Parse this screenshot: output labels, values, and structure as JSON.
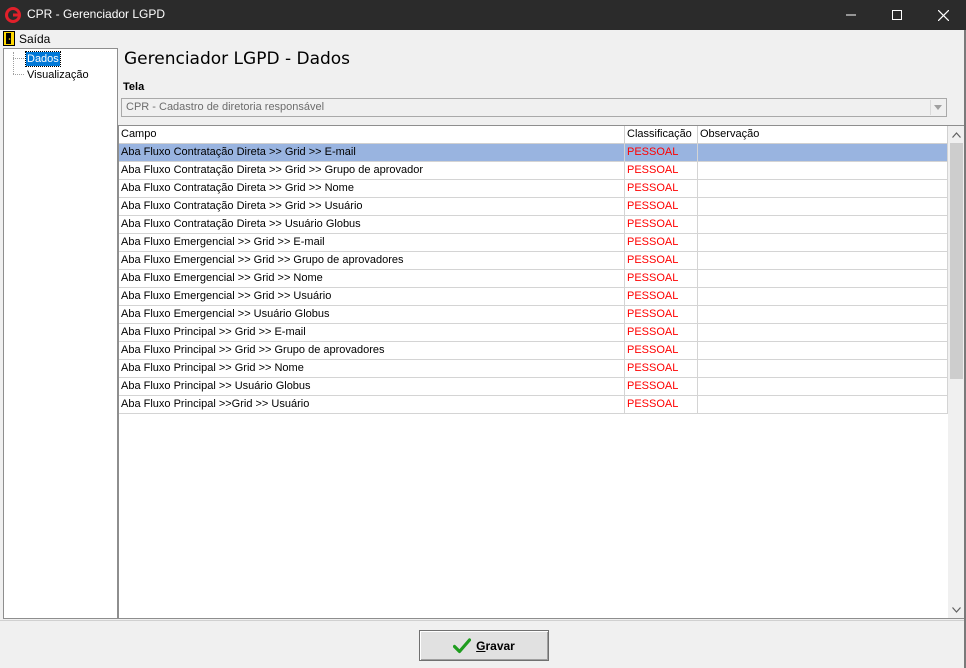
{
  "window": {
    "title": "CPR - Gerenciador LGPD"
  },
  "menu": {
    "exit_label": "Saída"
  },
  "tree": {
    "items": [
      {
        "label": "Dados",
        "selected": true
      },
      {
        "label": "Visualização",
        "selected": false
      }
    ]
  },
  "page": {
    "title": "Gerenciador LGPD - Dados"
  },
  "tela": {
    "label": "Tela",
    "value": "CPR - Cadastro de diretoria responsável"
  },
  "grid": {
    "columns": {
      "campo": "Campo",
      "classificacao": "Classificação",
      "observacao": "Observação"
    },
    "rows": [
      {
        "campo": "Aba Fluxo Contratação Direta >> Grid >> E-mail",
        "classificacao": "PESSOAL",
        "observacao": ""
      },
      {
        "campo": "Aba Fluxo Contratação Direta >> Grid >> Grupo de aprovador",
        "classificacao": "PESSOAL",
        "observacao": ""
      },
      {
        "campo": "Aba Fluxo Contratação Direta >> Grid >> Nome",
        "classificacao": "PESSOAL",
        "observacao": ""
      },
      {
        "campo": "Aba Fluxo Contratação Direta >> Grid >> Usuário",
        "classificacao": "PESSOAL",
        "observacao": ""
      },
      {
        "campo": "Aba Fluxo Contratação Direta >> Usuário Globus",
        "classificacao": "PESSOAL",
        "observacao": ""
      },
      {
        "campo": "Aba Fluxo Emergencial >> Grid >> E-mail",
        "classificacao": "PESSOAL",
        "observacao": ""
      },
      {
        "campo": "Aba Fluxo Emergencial >> Grid >> Grupo de aprovadores",
        "classificacao": "PESSOAL",
        "observacao": ""
      },
      {
        "campo": "Aba Fluxo Emergencial >> Grid >> Nome",
        "classificacao": "PESSOAL",
        "observacao": ""
      },
      {
        "campo": "Aba Fluxo Emergencial >> Grid >> Usuário",
        "classificacao": "PESSOAL",
        "observacao": ""
      },
      {
        "campo": "Aba Fluxo Emergencial >> Usuário Globus",
        "classificacao": "PESSOAL",
        "observacao": ""
      },
      {
        "campo": "Aba Fluxo Principal >> Grid >> E-mail",
        "classificacao": "PESSOAL",
        "observacao": ""
      },
      {
        "campo": "Aba Fluxo Principal >> Grid >> Grupo de aprovadores",
        "classificacao": "PESSOAL",
        "observacao": ""
      },
      {
        "campo": "Aba Fluxo Principal >> Grid >> Nome",
        "classificacao": "PESSOAL",
        "observacao": ""
      },
      {
        "campo": "Aba Fluxo Principal >> Usuário Globus",
        "classificacao": "PESSOAL",
        "observacao": ""
      },
      {
        "campo": "Aba Fluxo Principal >>Grid >> Usuário",
        "classificacao": "PESSOAL",
        "observacao": ""
      }
    ],
    "selected_row": 0
  },
  "actions": {
    "save_mnemonic": "G",
    "save_rest": "ravar"
  },
  "colors": {
    "titlebar": "#2b2b2b",
    "selection": "#99b4e0",
    "classification_text": "#ff0000",
    "tree_selection": "#0078d7"
  }
}
